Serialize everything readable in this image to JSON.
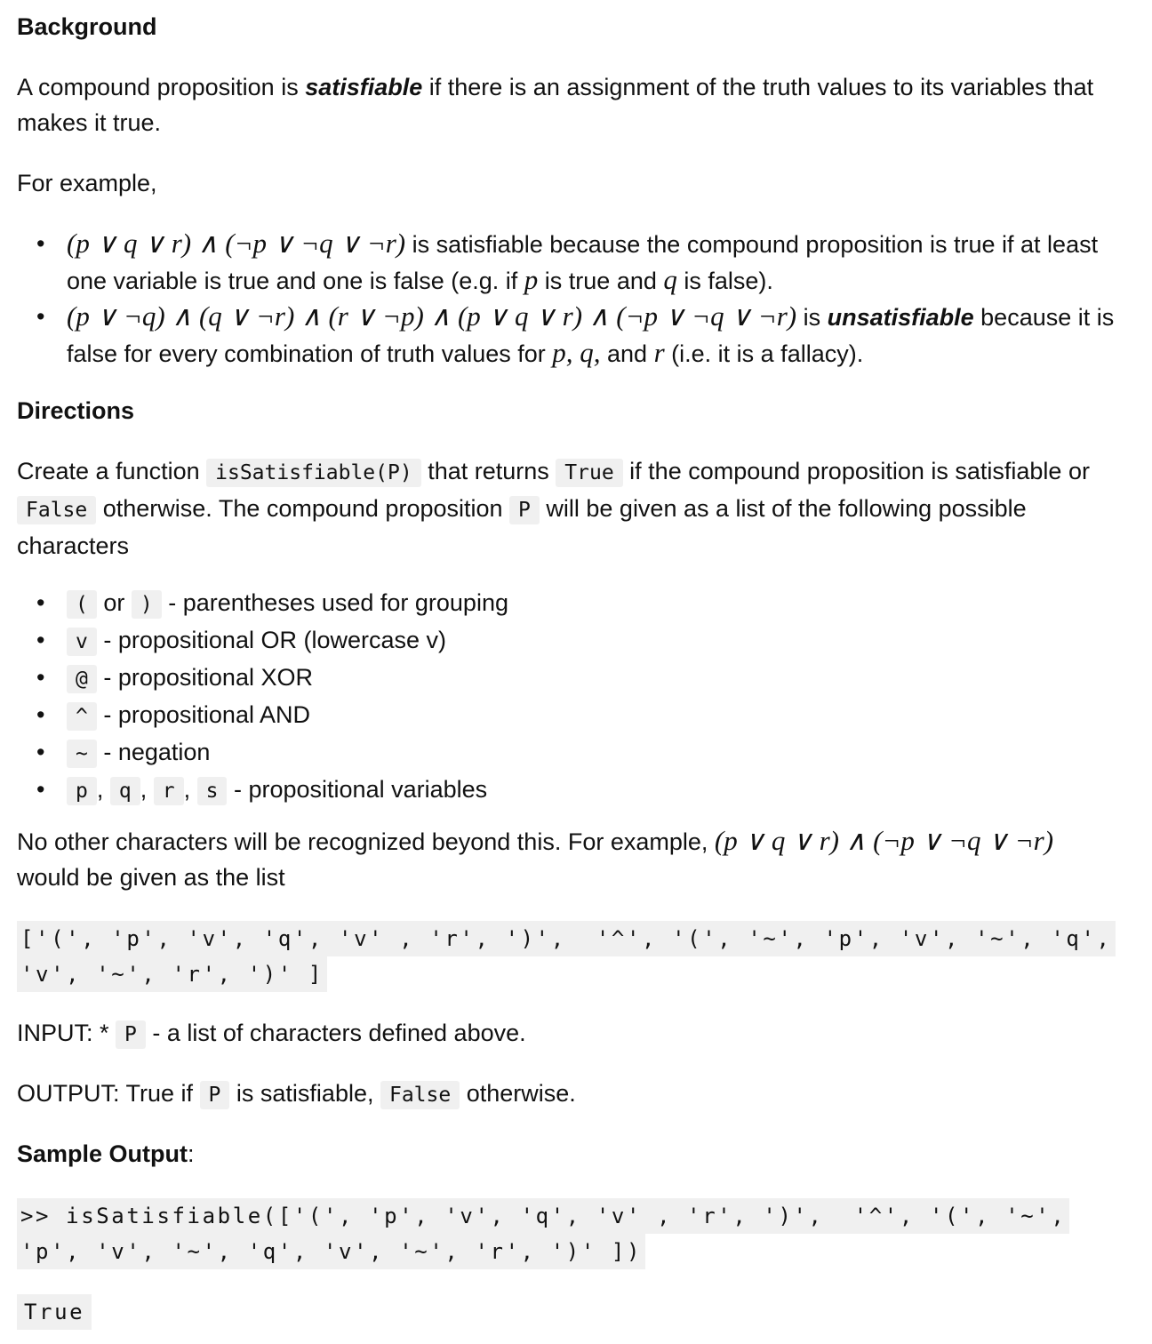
{
  "background": {
    "heading": "Background",
    "p1_start": "A compound proposition is ",
    "p1_emph": "satisfiable",
    "p1_end": " if there is an assignment of the truth values to its variables that makes it true.",
    "p2": "For example,",
    "b1_math": "(p ∨ q ∨ r) ∧ (¬p ∨ ¬q ∨ ¬r)",
    "b1_text_a": " is satisfiable because the compound proposition is true if at least one variable is true and one is false (e.g. if ",
    "b1_p": "p",
    "b1_text_b": " is true and ",
    "b1_q": "q",
    "b1_text_c": " is false).",
    "b2_math": "(p ∨ ¬q) ∧ (q ∨ ¬r) ∧ (r ∨ ¬p) ∧ (p ∨ q ∨ r) ∧ (¬p ∨ ¬q ∨ ¬r)",
    "b2_text_a": " is ",
    "b2_emph": "unsatisfiable",
    "b2_text_b": " because it is false for every combination of truth values for ",
    "b2_vars": "p, q,",
    "b2_text_c": " and ",
    "b2_r": "r",
    "b2_text_d": " (i.e. it is a fallacy)."
  },
  "directions": {
    "heading": "Directions",
    "p1_a": "Create a function ",
    "fn": "isSatisfiable(P)",
    "p1_b": " that returns ",
    "true_code": "True",
    "p1_c": " if the compound proposition is satisfiable or ",
    "false_code": "False",
    "p1_d": " otherwise. The compound proposition ",
    "p_code": "P",
    "p1_e": " will be given as a list of the following possible characters",
    "items": [
      {
        "code1": "(",
        "mid": " or ",
        "code2": ")",
        "text": " - parentheses used for grouping"
      },
      {
        "code1": "v",
        "text": " - propositional OR (lowercase v)"
      },
      {
        "code1": "@",
        "text": " - propositional XOR"
      },
      {
        "code1": "^",
        "text": " - propositional AND"
      },
      {
        "code1": "~",
        "text": " - negation"
      },
      {
        "codes": [
          "p",
          "q",
          "r",
          "s"
        ],
        "sep": ", ",
        "text": " - propositional variables"
      }
    ],
    "p2_a": "No other characters will be recognized beyond this. For example, ",
    "p2_math": "(p ∨ q ∨ r) ∧ (¬p ∨ ¬q ∨ ¬r)",
    "p2_b": " would be given as the list",
    "list_line1": "['(', 'p', 'v', 'q', 'v' , 'r', ')',  '^', '(', '~', 'p', 'v', '~', 'q',",
    "list_line2": "'v', '~', 'r', ')' ]",
    "input_a": "INPUT: * ",
    "input_code": "P",
    "input_b": " - a list of characters defined above.",
    "output_a": "OUTPUT: True if ",
    "output_code": "P",
    "output_b": " is satisfiable, ",
    "output_code2": "False",
    "output_c": " otherwise.",
    "sample_heading": "Sample Output",
    "sample_colon": ":",
    "sample_line1": ">> isSatisfiable(['(', 'p', 'v', 'q', 'v' , 'r', ')',  '^', '(', '~',",
    "sample_line2": "'p', 'v', '~', 'q', 'v', '~', 'r', ')' ])",
    "sample_result": "True"
  }
}
